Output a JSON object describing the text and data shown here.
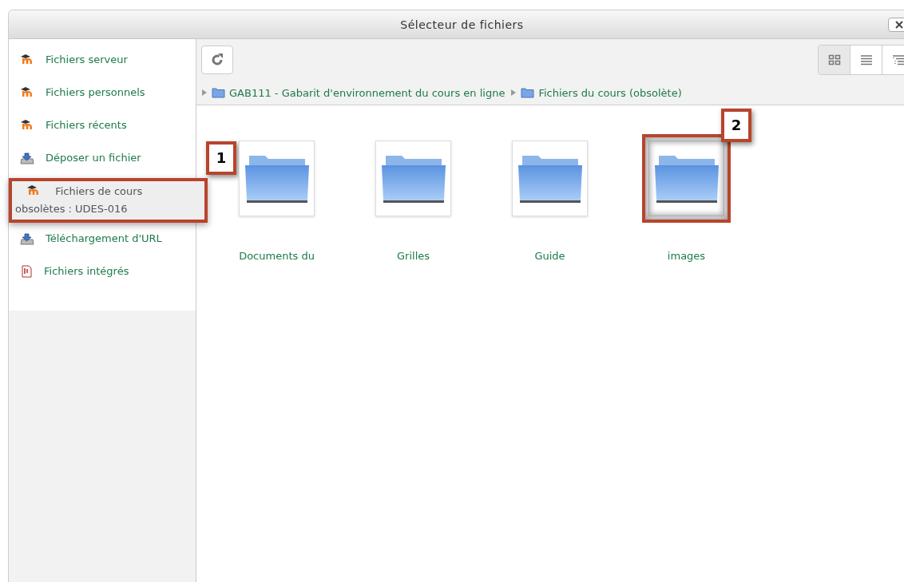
{
  "window": {
    "title": "Sélecteur de fichiers"
  },
  "sidebar": {
    "items": [
      {
        "label": "Fichiers serveur",
        "kind": "moodle",
        "selected": false,
        "highlighted": false
      },
      {
        "label": "Fichiers personnels",
        "kind": "moodle",
        "selected": false,
        "highlighted": false
      },
      {
        "label": "Fichiers récents",
        "kind": "moodle",
        "selected": false,
        "highlighted": false
      },
      {
        "label": "Déposer un fichier",
        "kind": "upload",
        "selected": false,
        "highlighted": false
      },
      {
        "label": "Fichiers de cours obsolètes : UDES-016",
        "kind": "moodle",
        "selected": true,
        "highlighted": true,
        "callout": "1"
      },
      {
        "label": "Téléchargement d'URL",
        "kind": "upload",
        "selected": false,
        "highlighted": false
      },
      {
        "label": "Fichiers intégrés",
        "kind": "pdf",
        "selected": false,
        "highlighted": false
      }
    ]
  },
  "view_buttons": [
    {
      "kind": "icons",
      "selected": true
    },
    {
      "kind": "list",
      "selected": false
    },
    {
      "kind": "tree",
      "selected": false
    }
  ],
  "breadcrumb": [
    "GAB111 - Gabarit d'environnement du cours en ligne",
    "Fichiers du cours (obsolète)"
  ],
  "folders": [
    {
      "name": "Documents du",
      "highlighted": false
    },
    {
      "name": "Grilles",
      "highlighted": false
    },
    {
      "name": "Guide",
      "highlighted": false
    },
    {
      "name": "images",
      "highlighted": true,
      "callout": "2"
    }
  ]
}
